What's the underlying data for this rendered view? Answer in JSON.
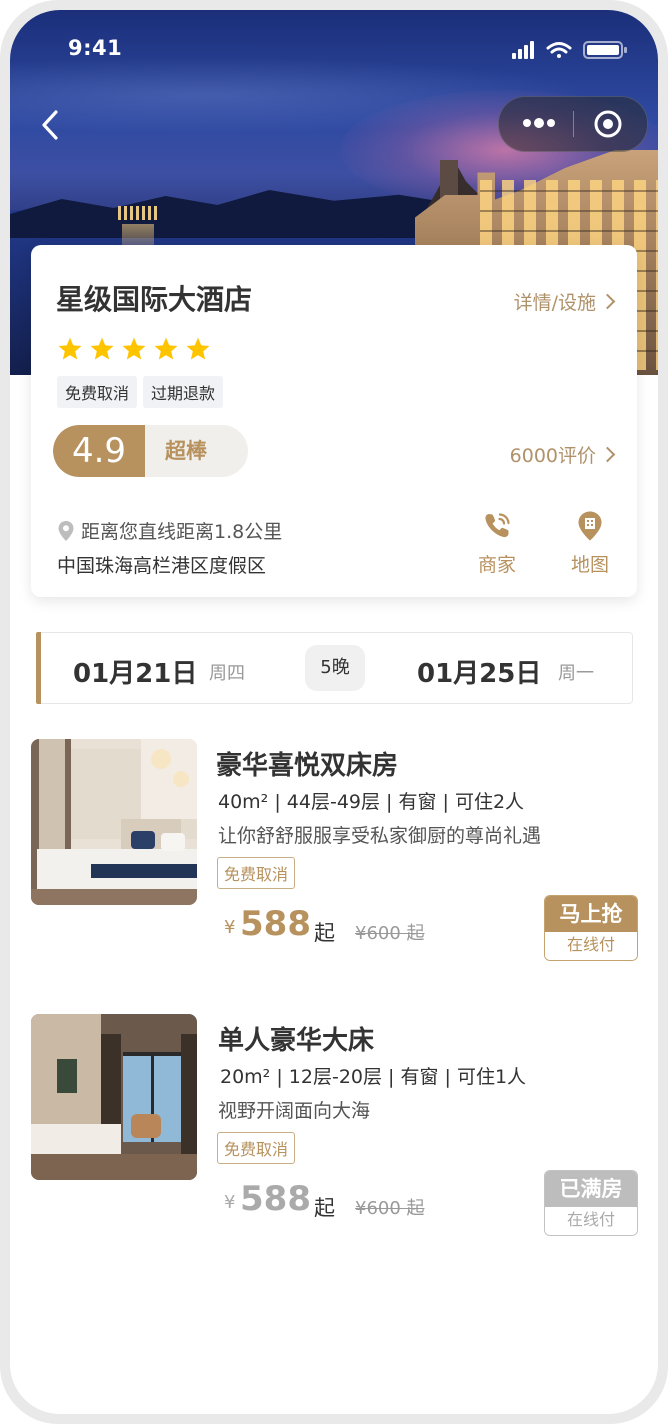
{
  "status": {
    "time": "9:41"
  },
  "hotel": {
    "name": "星级国际大酒店",
    "detail_link": "详情/设施",
    "stars": 5,
    "tags": [
      "免费取消",
      "过期退款"
    ],
    "rating": "4.9",
    "rating_word": "超棒",
    "reviews": "6000评价",
    "distance": "距离您直线距离1.8公里",
    "address": "中国珠海高栏港区度假区",
    "actions": {
      "merchant": "商家",
      "map": "地图"
    }
  },
  "dates": {
    "checkin": "01月21日",
    "checkin_weekday": "周四",
    "nights": "5晚",
    "checkout": "01月25日",
    "checkout_weekday": "周一"
  },
  "rooms": [
    {
      "name": "豪华喜悦双床房",
      "spec": "40m² | 44层-49层 | 有窗 | 可住2人",
      "desc": "让你舒舒服服享受私家御厨的尊尚礼遇",
      "tag": "免费取消",
      "currency": "¥",
      "price": "588",
      "from": "起",
      "old_price": "¥600 起",
      "button_top": "马上抢",
      "button_bottom": "在线付"
    },
    {
      "name": "单人豪华大床",
      "spec": "20m² | 12层-20层 | 有窗 | 可住1人",
      "desc": "视野开阔面向大海",
      "tag": "免费取消",
      "currency": "¥",
      "price": "588",
      "from": "起",
      "old_price": "¥600 起",
      "button_top": "已满房",
      "button_bottom": "在线付"
    }
  ],
  "colors": {
    "accent": "#b7925e",
    "star": "#ffc400",
    "soldout": "#bdbdbd"
  }
}
